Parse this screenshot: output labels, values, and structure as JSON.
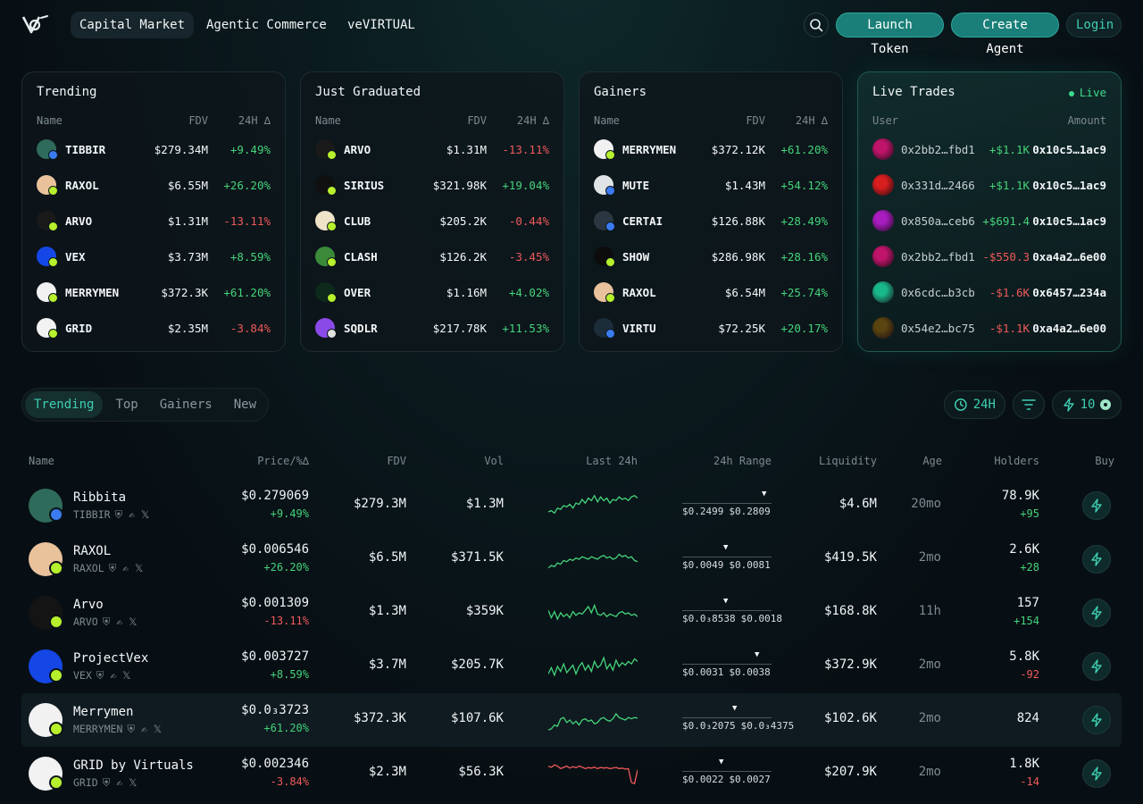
{
  "header": {
    "nav": [
      "Capital Market",
      "Agentic Commerce",
      "veVIRTUAL"
    ],
    "launch_token": "Launch Token",
    "create_agent": "Create Agent",
    "login": "Login"
  },
  "cards": {
    "trending": {
      "title": "Trending",
      "head_name": "Name",
      "head_fdv": "FDV",
      "head_chg": "24H ∆",
      "rows": [
        {
          "name": "TIBBIR",
          "fdv": "$279.34M",
          "chg": "+9.49%",
          "dir": "up",
          "color": "#2f6b5a",
          "badge": "#3a7bf0"
        },
        {
          "name": "RAXOL",
          "fdv": "$6.55M",
          "chg": "+26.20%",
          "dir": "up",
          "color": "#e9c29c",
          "badge": "#b7f02c"
        },
        {
          "name": "ARVO",
          "fdv": "$1.31M",
          "chg": "-13.11%",
          "dir": "down",
          "color": "#1a1a1a",
          "badge": "#b7f02c"
        },
        {
          "name": "VEX",
          "fdv": "$3.73M",
          "chg": "+8.59%",
          "dir": "up",
          "color": "#1447e6",
          "badge": "#b7f02c"
        },
        {
          "name": "MERRYMEN",
          "fdv": "$372.3K",
          "chg": "+61.20%",
          "dir": "up",
          "color": "#f1f1f1",
          "badge": "#b7f02c"
        },
        {
          "name": "GRID",
          "fdv": "$2.35M",
          "chg": "-3.84%",
          "dir": "down",
          "color": "#f2f2f2",
          "badge": "#b7f02c"
        }
      ]
    },
    "graduated": {
      "title": "Just Graduated",
      "head_name": "Name",
      "head_fdv": "FDV",
      "head_chg": "24H ∆",
      "rows": [
        {
          "name": "ARVO",
          "fdv": "$1.31M",
          "chg": "-13.11%",
          "dir": "down",
          "color": "#1a1a1a",
          "badge": "#b7f02c"
        },
        {
          "name": "SIRIUS",
          "fdv": "$321.98K",
          "chg": "+19.04%",
          "dir": "up",
          "color": "#101010",
          "badge": "#b7f02c"
        },
        {
          "name": "CLUB",
          "fdv": "$205.2K",
          "chg": "-0.44%",
          "dir": "down",
          "color": "#efe3c8",
          "badge": "#b7f02c"
        },
        {
          "name": "CLASH",
          "fdv": "$126.2K",
          "chg": "-3.45%",
          "dir": "down",
          "color": "#3a8a3a",
          "badge": "#b7f02c"
        },
        {
          "name": "OVER",
          "fdv": "$1.16M",
          "chg": "+4.02%",
          "dir": "up",
          "color": "#0d2a1c",
          "badge": "#b7f02c"
        },
        {
          "name": "SQDLR",
          "fdv": "$217.78K",
          "chg": "+11.53%",
          "dir": "up",
          "color": "#8a4ae8",
          "badge": "#e0e0e0"
        }
      ]
    },
    "gainers": {
      "title": "Gainers",
      "head_name": "Name",
      "head_fdv": "FDV",
      "head_chg": "24H ∆",
      "rows": [
        {
          "name": "MERRYMEN",
          "fdv": "$372.12K",
          "chg": "+61.20%",
          "dir": "up",
          "color": "#f1f1f1",
          "badge": "#b7f02c"
        },
        {
          "name": "MUTE",
          "fdv": "$1.43M",
          "chg": "+54.12%",
          "dir": "up",
          "color": "#dfe4e6",
          "badge": "#3a7bf0"
        },
        {
          "name": "CERTAI",
          "fdv": "$126.88K",
          "chg": "+28.49%",
          "dir": "up",
          "color": "#2a3640",
          "badge": "#3a7bf0"
        },
        {
          "name": "SHOW",
          "fdv": "$286.98K",
          "chg": "+28.16%",
          "dir": "up",
          "color": "#0c0c0c",
          "badge": "#b7f02c"
        },
        {
          "name": "RAXOL",
          "fdv": "$6.54M",
          "chg": "+25.74%",
          "dir": "up",
          "color": "#e9c29c",
          "badge": "#b7f02c"
        },
        {
          "name": "VIRTU",
          "fdv": "$72.25K",
          "chg": "+20.17%",
          "dir": "up",
          "color": "#1c2d3a",
          "badge": "#3a7bf0"
        }
      ]
    },
    "live": {
      "title": "Live Trades",
      "live_label": "Live",
      "head_user": "User",
      "head_amount": "Amount",
      "rows": [
        {
          "user": "0x2bb2…fbd1",
          "amt": "+$1.1K",
          "dir": "up",
          "addr": "0x10c5…1ac9",
          "color": "#c0146a"
        },
        {
          "user": "0x331d…2466",
          "amt": "+$1.1K",
          "dir": "up",
          "addr": "0x10c5…1ac9",
          "color": "#d81e1e"
        },
        {
          "user": "0x850a…ceb6",
          "amt": "+$691.4",
          "dir": "up",
          "addr": "0x10c5…1ac9",
          "color": "#a81cc0"
        },
        {
          "user": "0x2bb2…fbd1",
          "amt": "-$550.3",
          "dir": "down",
          "addr": "0xa4a2…6e00",
          "color": "#c0146a"
        },
        {
          "user": "0x6cdc…b3cb",
          "amt": "-$1.6K",
          "dir": "down",
          "addr": "0x6457…234a",
          "color": "#18b88a"
        },
        {
          "user": "0x54e2…bc75",
          "amt": "-$1.1K",
          "dir": "down",
          "addr": "0xa4a2…6e00",
          "color": "#5a4410"
        }
      ]
    }
  },
  "tabs": [
    "Trending",
    "Top",
    "Gainers",
    "New"
  ],
  "filters": {
    "period": "24H",
    "count": "10"
  },
  "table": {
    "headers": {
      "name": "Name",
      "price": "Price/%∆",
      "fdv": "FDV",
      "vol": "Vol",
      "last24": "Last 24h",
      "range": "24h Range",
      "liq": "Liquidity",
      "age": "Age",
      "holders": "Holders",
      "buy": "Buy"
    },
    "rows": [
      {
        "name": "Ribbita",
        "sym": "TIBBIR",
        "price": "$0.279069",
        "pct": "+9.49%",
        "dir": "up",
        "fdv": "$279.3M",
        "vol": "$1.3M",
        "lo": "$0.2499",
        "hi": "$0.2809",
        "pos": 0.93,
        "liq": "$4.6M",
        "age": "20mo",
        "holders": "78.9K",
        "hdelta": "+95",
        "hdir": "up",
        "color": "#2f6b5a",
        "badge": "#3a7bf0",
        "spark_color": "#45d37a",
        "spark": [
          0.25,
          0.3,
          0.2,
          0.4,
          0.35,
          0.5,
          0.45,
          0.55,
          0.4,
          0.6,
          0.55,
          0.75,
          0.6,
          0.8,
          0.7,
          0.9,
          0.65,
          0.85,
          0.7,
          0.8,
          0.6,
          0.75,
          0.7,
          0.85,
          0.75,
          0.8,
          0.7,
          0.85,
          0.9,
          0.8
        ]
      },
      {
        "name": "RAXOL",
        "sym": "RAXOL",
        "price": "$0.006546",
        "pct": "+26.20%",
        "dir": "up",
        "fdv": "$6.5M",
        "vol": "$371.5K",
        "lo": "$0.0049",
        "hi": "$0.0081",
        "pos": 0.5,
        "liq": "$419.5K",
        "age": "2mo",
        "holders": "2.6K",
        "hdelta": "+28",
        "hdir": "up",
        "color": "#e9c29c",
        "badge": "#b7f02c",
        "spark_color": "#45d37a",
        "spark": [
          0.15,
          0.25,
          0.2,
          0.35,
          0.3,
          0.45,
          0.4,
          0.5,
          0.45,
          0.55,
          0.5,
          0.6,
          0.55,
          0.5,
          0.6,
          0.55,
          0.5,
          0.6,
          0.65,
          0.55,
          0.6,
          0.5,
          0.55,
          0.7,
          0.6,
          0.65,
          0.55,
          0.6,
          0.45,
          0.4
        ]
      },
      {
        "name": "Arvo",
        "sym": "ARVO",
        "price": "$0.001309",
        "pct": "-13.11%",
        "dir": "down",
        "fdv": "$1.3M",
        "vol": "$359K",
        "lo": "$0.0₃8538",
        "hi": "$0.0018",
        "pos": 0.5,
        "liq": "$168.8K",
        "age": "11h",
        "holders": "157",
        "hdelta": "+154",
        "hdir": "up",
        "color": "#141414",
        "badge": "#b7f02c",
        "spark_color": "#45d37a",
        "spark": [
          0.6,
          0.3,
          0.55,
          0.25,
          0.5,
          0.35,
          0.45,
          0.3,
          0.55,
          0.4,
          0.5,
          0.45,
          0.6,
          0.75,
          0.5,
          0.8,
          0.45,
          0.4,
          0.5,
          0.35,
          0.45,
          0.4,
          0.35,
          0.5,
          0.55,
          0.45,
          0.5,
          0.4,
          0.45,
          0.35
        ]
      },
      {
        "name": "ProjectVex",
        "sym": "VEX",
        "price": "$0.003727",
        "pct": "+8.59%",
        "dir": "up",
        "fdv": "$3.7M",
        "vol": "$205.7K",
        "lo": "$0.0031",
        "hi": "$0.0038",
        "pos": 0.85,
        "liq": "$372.9K",
        "age": "2mo",
        "holders": "5.8K",
        "hdelta": "-92",
        "hdir": "down",
        "color": "#1447e6",
        "badge": "#b7f02c",
        "spark_color": "#45d37a",
        "spark": [
          0.2,
          0.45,
          0.15,
          0.5,
          0.3,
          0.6,
          0.25,
          0.4,
          0.55,
          0.2,
          0.5,
          0.65,
          0.35,
          0.55,
          0.3,
          0.7,
          0.45,
          0.55,
          0.85,
          0.4,
          0.6,
          0.35,
          0.75,
          0.5,
          0.65,
          0.55,
          0.7,
          0.6,
          0.8,
          0.7
        ]
      },
      {
        "name": "Merrymen",
        "sym": "MERRYMEN",
        "price": "$0.0₃3723",
        "pct": "+61.20%",
        "dir": "up",
        "fdv": "$372.3K",
        "vol": "$107.6K",
        "lo": "$0.0₃2075",
        "hi": "$0.0₃4375",
        "pos": 0.6,
        "liq": "$102.6K",
        "age": "2mo",
        "holders": "824",
        "hdelta": "",
        "hdir": "up",
        "color": "#f1f1f1",
        "badge": "#b7f02c",
        "spark_color": "#45d37a",
        "spark": [
          0.1,
          0.15,
          0.3,
          0.25,
          0.55,
          0.6,
          0.4,
          0.5,
          0.35,
          0.45,
          0.3,
          0.5,
          0.55,
          0.45,
          0.5,
          0.35,
          0.4,
          0.55,
          0.6,
          0.5,
          0.45,
          0.55,
          0.75,
          0.6,
          0.55,
          0.5,
          0.6,
          0.55,
          0.6,
          0.58
        ]
      },
      {
        "name": "GRID by Virtuals",
        "sym": "GRID",
        "price": "$0.002346",
        "pct": "-3.84%",
        "dir": "down",
        "fdv": "$2.3M",
        "vol": "$56.3K",
        "lo": "$0.0022",
        "hi": "$0.0027",
        "pos": 0.45,
        "liq": "$207.9K",
        "age": "2mo",
        "holders": "1.8K",
        "hdelta": "-14",
        "hdir": "down",
        "color": "#f2f2f2",
        "badge": "#b7f02c",
        "spark_color": "#ef5a5a",
        "spark": [
          0.8,
          0.75,
          0.85,
          0.8,
          0.7,
          0.75,
          0.8,
          0.72,
          0.78,
          0.74,
          0.8,
          0.76,
          0.7,
          0.74,
          0.72,
          0.76,
          0.7,
          0.75,
          0.72,
          0.74,
          0.7,
          0.72,
          0.75,
          0.7,
          0.72,
          0.68,
          0.7,
          0.15,
          0.1,
          0.65
        ]
      }
    ]
  }
}
